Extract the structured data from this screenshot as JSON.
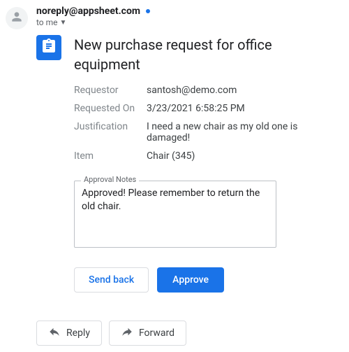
{
  "sender": "noreply@appsheet.com",
  "recipient_label": "to me",
  "subject": "New purchase request for office equipment",
  "fields": [
    {
      "label": "Requestor",
      "value": "santosh@demo.com"
    },
    {
      "label": "Requested On",
      "value": "3/23/2021 6:58:25 PM"
    },
    {
      "label": "Justification",
      "value": "I need a new chair as my old one is damaged!"
    },
    {
      "label": "Item",
      "value": "Chair (345)"
    }
  ],
  "approval_notes_legend": "Approval Notes",
  "approval_notes_value": "Approved! Please remember to return the old chair.",
  "buttons": {
    "send_back": "Send back",
    "approve": "Approve"
  },
  "email_actions": {
    "reply": "Reply",
    "forward": "Forward"
  }
}
